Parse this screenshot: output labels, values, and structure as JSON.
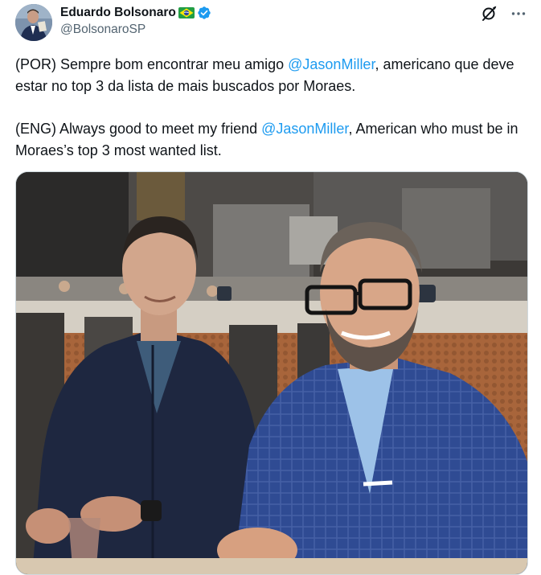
{
  "author": {
    "display_name": "Eduardo Bolsonaro",
    "handle": "@BolsonaroSP",
    "flag_icon": "brazil-flag-icon",
    "verified_icon": "verified-badge-icon"
  },
  "actions": {
    "grok_icon": "grok-icon",
    "more_icon": "more-options-icon"
  },
  "post": {
    "por": {
      "before": "(POR) Sempre bom encontrar meu amigo ",
      "mention": "@JasonMiller",
      "after": ", americano que deve estar no top 3 da lista de mais buscados por Moraes."
    },
    "eng": {
      "before": "(ENG) Always good to meet my friend ",
      "mention": "@JasonMiller",
      "after": ", American who must be in Moraes’s top 3 most wanted list."
    }
  },
  "colors": {
    "text": "#0f1419",
    "secondary": "#536471",
    "link": "#1d9bf0",
    "verified": "#1d9bf0"
  }
}
